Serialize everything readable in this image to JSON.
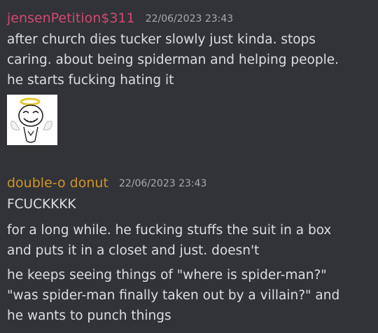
{
  "colors": {
    "background": "#313338",
    "text": "#dbdee1",
    "timestamp": "#a6a9ae",
    "user1": "#d3486f",
    "user2": "#d19426"
  },
  "messages": [
    {
      "author": "jensenPetition$311",
      "timestamp": "22/06/2023 23:43",
      "lines": [
        "after church dies tucker slowly just kinda. stops",
        "caring. about being spiderman and helping people.",
        "he starts fucking hating it"
      ],
      "attachment": {
        "icon": "angel-meme-face-image"
      }
    },
    {
      "author": "double-o donut",
      "timestamp": "22/06/2023 23:43",
      "blocks": [
        [
          "FCUCKKKK"
        ],
        [
          "for a long while. he fucking stuffs the suit in a box",
          "and puts it in a closet and just. doesn't"
        ],
        [
          "he keeps seeing things of \"where is spider-man?\"",
          "\"was spider-man finally taken out by a villain?\" and",
          "he wants to punch things"
        ]
      ]
    }
  ]
}
